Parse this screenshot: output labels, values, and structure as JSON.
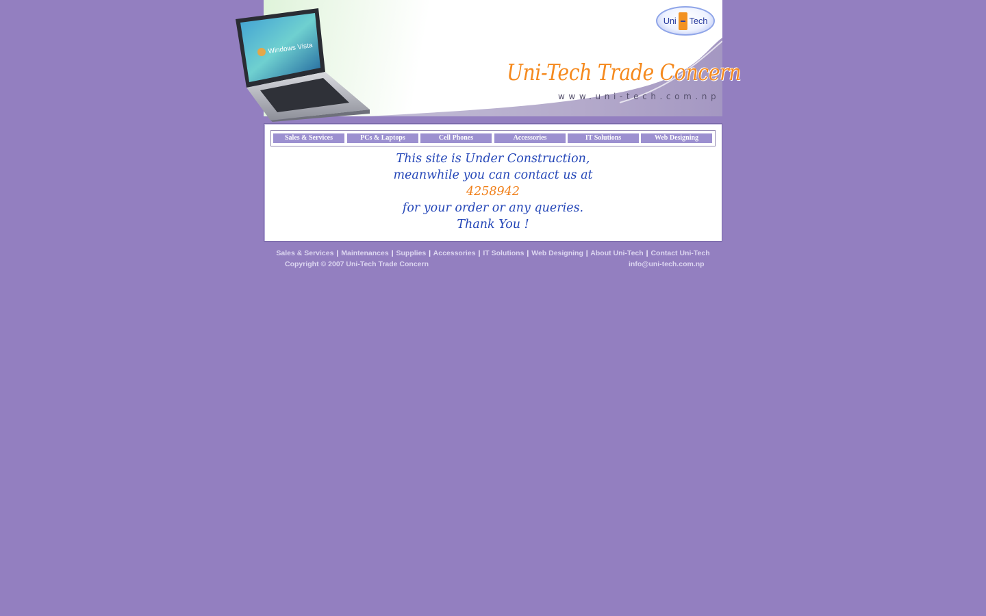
{
  "header": {
    "logo_text_left": "Uni",
    "logo_text_right": "Tech",
    "brand_title": "Uni-Tech Trade Concern",
    "brand_url": "www.uni-tech.com.np",
    "laptop_screen_text": "Windows Vista"
  },
  "nav": {
    "items": [
      {
        "label": "Sales & Services"
      },
      {
        "label": "PCs & Laptops"
      },
      {
        "label": "Cell Phones"
      },
      {
        "label": "Accessories"
      },
      {
        "label": "IT Solutions"
      },
      {
        "label": "Web Designing"
      }
    ]
  },
  "message": {
    "line1": "This site is Under Construction,",
    "line2": "meanwhile you can contact us at",
    "phone": "4258942",
    "line3": "for your order or any queries.",
    "line4": "Thank You !"
  },
  "footer": {
    "links": [
      {
        "label": "Sales & Services"
      },
      {
        "label": "Maintenances"
      },
      {
        "label": "Supplies"
      },
      {
        "label": "Accessories"
      },
      {
        "label": "IT Solutions"
      },
      {
        "label": "Web Designing"
      },
      {
        "label": "About Uni-Tech"
      },
      {
        "label": "Contact Uni-Tech"
      }
    ],
    "separator": "|",
    "copyright": "Copyright © 2007 Uni-Tech Trade Concern",
    "email": "info@uni-tech.com.np"
  },
  "colors": {
    "page_background": "#937fc0",
    "nav_button": "#9c90d0",
    "brand_orange": "#f58a1f",
    "message_blue": "#2547b8"
  }
}
